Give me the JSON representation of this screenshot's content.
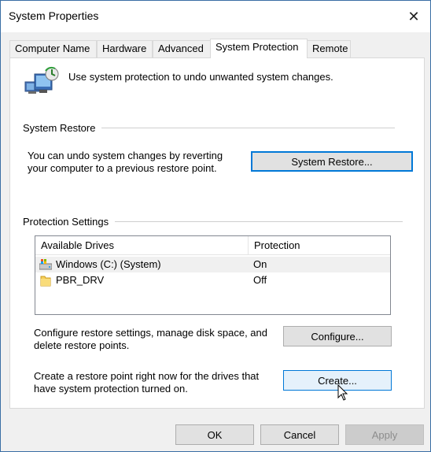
{
  "window": {
    "title": "System Properties"
  },
  "tabs": [
    {
      "label": "Computer Name"
    },
    {
      "label": "Hardware"
    },
    {
      "label": "Advanced"
    },
    {
      "label": "System Protection"
    },
    {
      "label": "Remote"
    }
  ],
  "active_tab": "System Protection",
  "intro": {
    "text": "Use system protection to undo unwanted system changes."
  },
  "system_restore": {
    "group_label": "System Restore",
    "description_line1": "You can undo system changes by reverting",
    "description_line2": "your computer to a previous restore point.",
    "button_label": "System Restore..."
  },
  "protection_settings": {
    "group_label": "Protection Settings",
    "columns": [
      "Available Drives",
      "Protection"
    ],
    "drives": [
      {
        "name": "Windows (C:) (System)",
        "protection": "On",
        "icon": "system-drive-icon",
        "selected": true
      },
      {
        "name": "PBR_DRV",
        "protection": "Off",
        "icon": "folder-drive-icon",
        "selected": false
      }
    ],
    "configure_text_line1": "Configure restore settings, manage disk space, and",
    "configure_text_line2": "delete restore points.",
    "configure_button": "Configure...",
    "create_text_line1": "Create a restore point right now for the drives that",
    "create_text_line2": "have system protection turned on.",
    "create_button": "Create..."
  },
  "footer": {
    "ok": "OK",
    "cancel": "Cancel",
    "apply": "Apply"
  },
  "colors": {
    "focus_border": "#0078d7",
    "hover_fill": "#e5f1fb",
    "disabled_text": "#8c8c8c"
  }
}
